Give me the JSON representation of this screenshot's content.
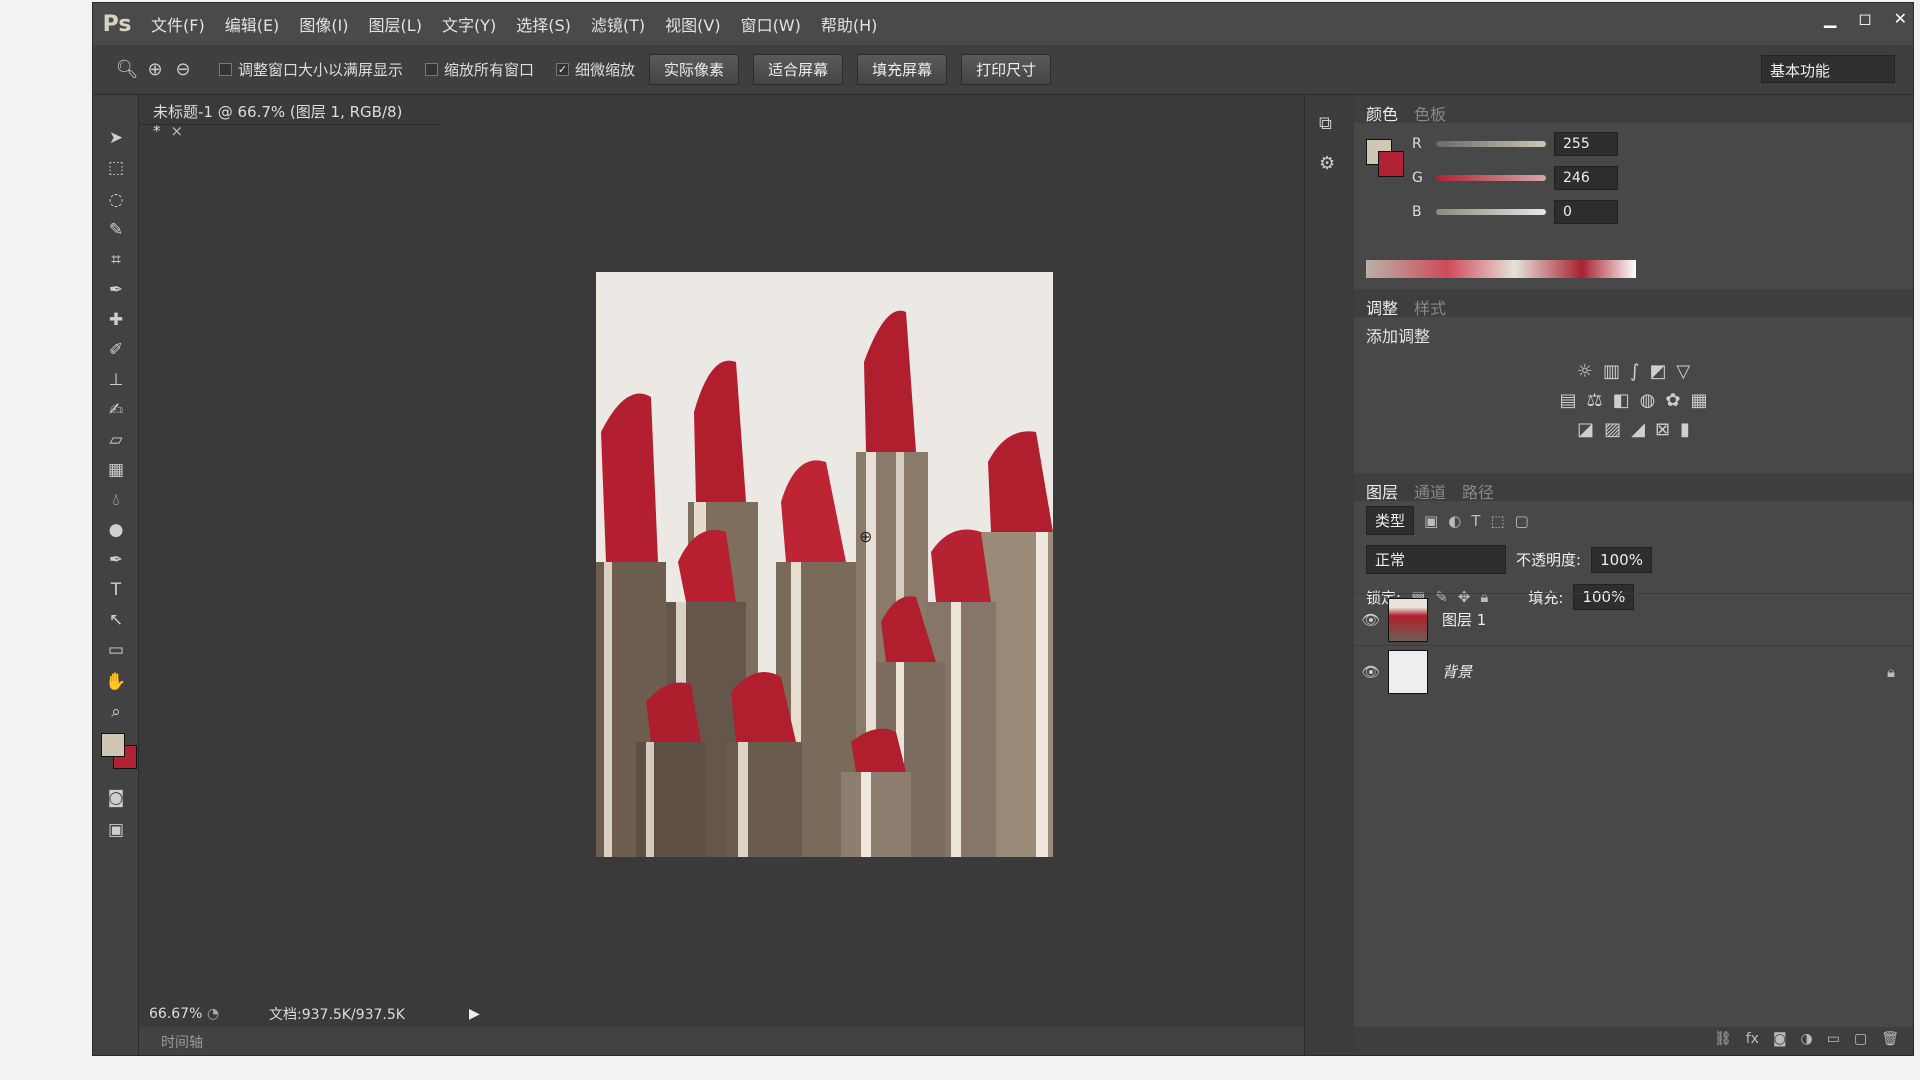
{
  "app": {
    "logo": "Ps"
  },
  "menu": [
    "文件(F)",
    "编辑(E)",
    "图像(I)",
    "图层(L)",
    "文字(Y)",
    "选择(S)",
    "滤镜(T)",
    "视图(V)",
    "窗口(W)",
    "帮助(H)"
  ],
  "window_controls": {
    "minimize": "▁",
    "restore": "◻",
    "close": "✕"
  },
  "options": {
    "resize_windows": "调整窗口大小以满屏显示",
    "zoom_all": "缩放所有窗口",
    "scrubby_zoom": "细微缩放",
    "scrubby_checked": true,
    "buttons": [
      "实际像素",
      "适合屏幕",
      "填充屏幕",
      "打印尺寸"
    ],
    "workspace": "基本功能"
  },
  "document": {
    "tab_title": "未标题-1 @ 66.7% (图层 1, RGB/8) *",
    "zoom": "66.67%",
    "doc_size": "文档:937.5K/937.5K",
    "timeline": "时间轴"
  },
  "color_panel": {
    "tabs": [
      "颜色",
      "色板"
    ],
    "R": {
      "label": "R",
      "value": "255"
    },
    "G": {
      "label": "G",
      "value": "246"
    },
    "B": {
      "label": "B",
      "value": "0"
    },
    "fg": "#cfc6b3",
    "bg": "#b02234"
  },
  "adjust_panel": {
    "tabs": [
      "调整",
      "样式"
    ],
    "title": "添加调整"
  },
  "layers_panel": {
    "tabs": [
      "图层",
      "通道",
      "路径"
    ],
    "filter": "类型",
    "blend_mode": "正常",
    "opacity_label": "不透明度:",
    "opacity": "100%",
    "lock_label": "锁定:",
    "fill_label": "填充:",
    "fill": "100%",
    "layers": [
      {
        "name": "图层 1"
      },
      {
        "name": "背景"
      }
    ]
  }
}
